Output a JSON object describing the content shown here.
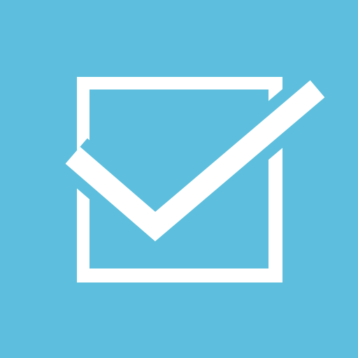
{
  "icon": {
    "name": "checkbox-checked-icon",
    "background_color": "#5dbfdd",
    "foreground_color": "#ffffff",
    "checked": true
  }
}
